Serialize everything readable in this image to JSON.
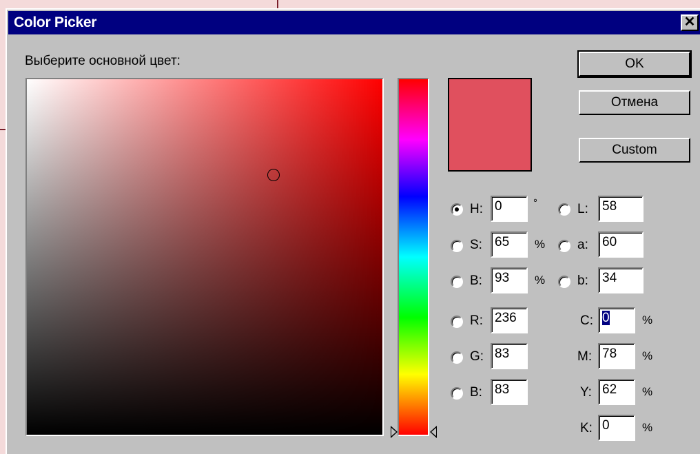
{
  "window": {
    "title": "Color Picker",
    "close_glyph": "✕"
  },
  "prompt": "Выберите основной цвет:",
  "buttons": {
    "ok": "OK",
    "cancel": "Отмена",
    "custom": "Custom"
  },
  "current_color": "#e0505e",
  "hsb": {
    "h": {
      "label": "H:",
      "value": "0",
      "unit": "°",
      "checked": true
    },
    "s": {
      "label": "S:",
      "value": "65",
      "unit": "%"
    },
    "b": {
      "label": "B:",
      "value": "93",
      "unit": "%"
    }
  },
  "lab": {
    "l": {
      "label": "L:",
      "value": "58"
    },
    "a": {
      "label": "a:",
      "value": "60"
    },
    "b": {
      "label": "b:",
      "value": "34"
    }
  },
  "rgb": {
    "r": {
      "label": "R:",
      "value": "236"
    },
    "g": {
      "label": "G:",
      "value": "83"
    },
    "b": {
      "label": "B:",
      "value": "83"
    }
  },
  "cmyk": {
    "c": {
      "label": "C:",
      "value": "0",
      "unit": "%"
    },
    "m": {
      "label": "M:",
      "value": "78",
      "unit": "%"
    },
    "y": {
      "label": "Y:",
      "value": "62",
      "unit": "%"
    },
    "k": {
      "label": "K:",
      "value": "0",
      "unit": "%"
    }
  }
}
